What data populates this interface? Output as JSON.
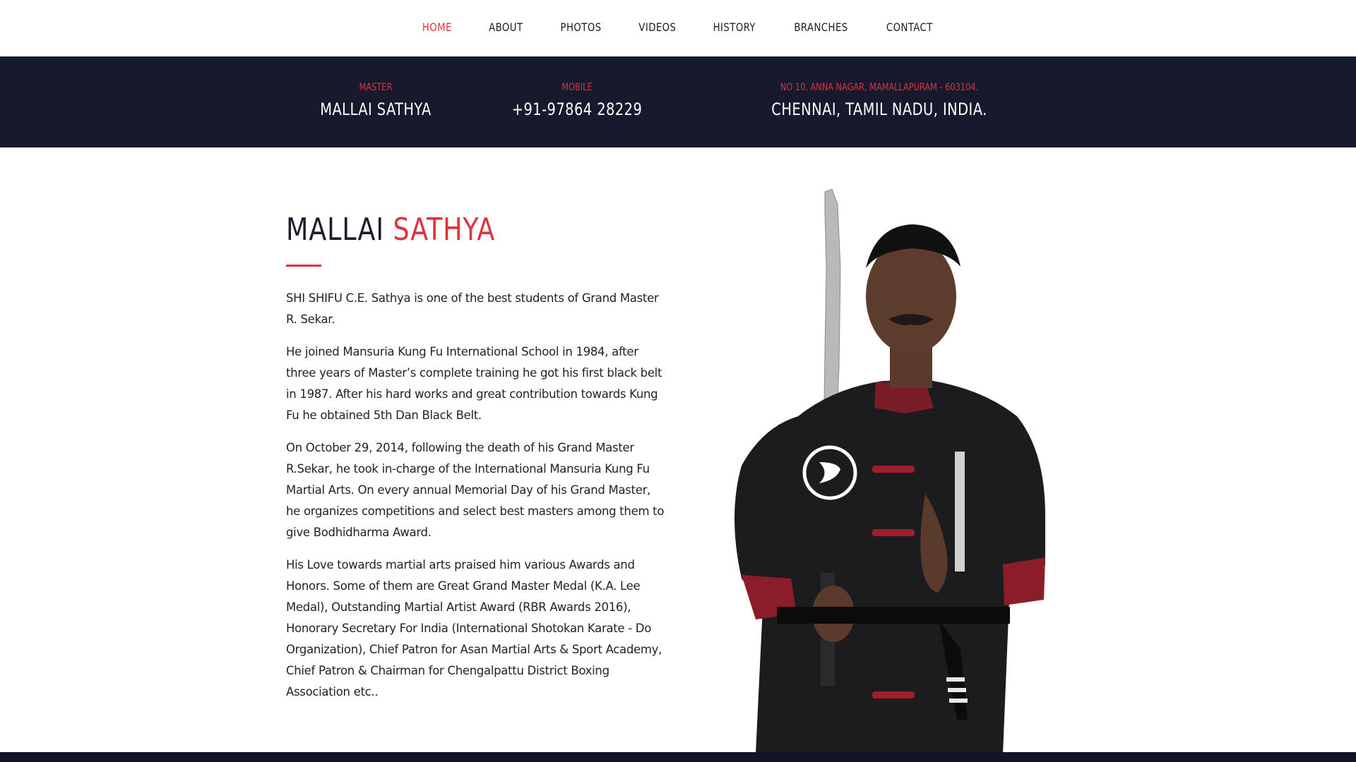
{
  "nav": {
    "items": [
      {
        "label": "HOME",
        "active": true
      },
      {
        "label": "ABOUT",
        "active": false
      },
      {
        "label": "PHOTOS",
        "active": false
      },
      {
        "label": "VIDEOS",
        "active": false
      },
      {
        "label": "HISTORY",
        "active": false
      },
      {
        "label": "BRANCHES",
        "active": false
      },
      {
        "label": "CONTACT",
        "active": false
      }
    ]
  },
  "info_bar": {
    "master_label": "MASTER",
    "master_value": "MALLAI SATHYA",
    "mobile_label": "MOBILE",
    "mobile_value": "+91-97864 28229",
    "address_label": "NO 10, ANNA NAGAR, MAMALLAPURAM - 603104.",
    "address_value": "CHENNAI, TAMIL NADU, INDIA."
  },
  "about": {
    "title_first": "MALLAI",
    "title_second": "SATHYA",
    "paragraphs": [
      "SHI SHIFU C.E. Sathya is one of the best students of Grand Master R. Sekar.",
      "He joined Mansuria Kung Fu International School in 1984, after three years of Master’s complete training he got his first black belt in 1987. After his hard works and great contribution towards Kung Fu he obtained 5th Dan Black Belt.",
      "On October 29, 2014, following the death of his Grand Master R.Sekar, he took in-charge of the International Mansuria Kung Fu Martial Arts. On every annual Memorial Day of his Grand Master, he organizes competitions and select best masters among them to give Bodhidharma Award.",
      "His Love towards martial arts praised him various Awards and Honors. Some of them are Great Grand Master Medal (K.A. Lee Medal), Outstanding Martial Artist Award (RBR Awards 2016), Honorary Secretary For India (International Shotokan Karate - Do Organization), Chief Patron for Asan Martial Arts & Sport Academy, Chief Patron & Chairman for Chengalpattu District Boxing Association etc.."
    ]
  },
  "colors": {
    "accent": "#e0313f",
    "dark": "#161a2c",
    "text": "#1a1c2c"
  }
}
